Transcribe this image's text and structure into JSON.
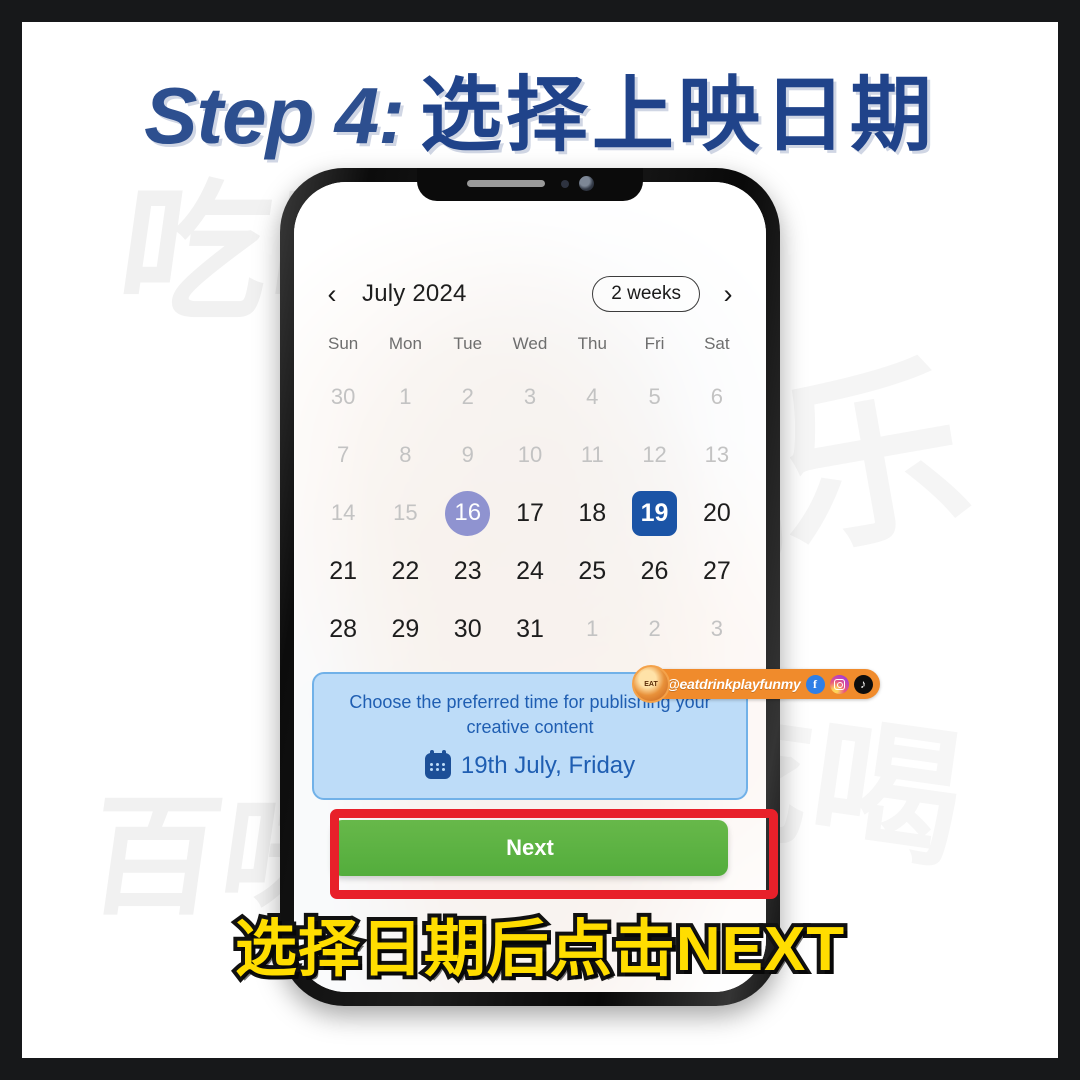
{
  "headline": {
    "english": "Step 4:",
    "chinese": "选择上映日期"
  },
  "background_watermark": {
    "line1": "吃喝",
    "line2": "百味玩",
    "line3": "玩乐",
    "line4": "吃喝"
  },
  "phone": {
    "notch": {
      "speaker": "speaker-grille",
      "sensor": "proximity-sensor",
      "camera": "front-camera"
    }
  },
  "calendar": {
    "prev_label": "‹",
    "next_label": "›",
    "month": "July 2024",
    "range_pill": "2 weeks",
    "weekdays": [
      "Sun",
      "Mon",
      "Tue",
      "Wed",
      "Thu",
      "Fri",
      "Sat"
    ],
    "weeks": [
      [
        {
          "d": "30",
          "state": "muted"
        },
        {
          "d": "1",
          "state": "muted"
        },
        {
          "d": "2",
          "state": "muted"
        },
        {
          "d": "3",
          "state": "muted"
        },
        {
          "d": "4",
          "state": "muted"
        },
        {
          "d": "5",
          "state": "muted"
        },
        {
          "d": "6",
          "state": "muted"
        }
      ],
      [
        {
          "d": "7",
          "state": "muted"
        },
        {
          "d": "8",
          "state": "muted"
        },
        {
          "d": "9",
          "state": "muted"
        },
        {
          "d": "10",
          "state": "muted"
        },
        {
          "d": "11",
          "state": "muted"
        },
        {
          "d": "12",
          "state": "muted"
        },
        {
          "d": "13",
          "state": "muted"
        }
      ],
      [
        {
          "d": "14",
          "state": "muted"
        },
        {
          "d": "15",
          "state": "muted"
        },
        {
          "d": "16",
          "state": "today"
        },
        {
          "d": "17",
          "state": "normal"
        },
        {
          "d": "18",
          "state": "normal"
        },
        {
          "d": "19",
          "state": "selected"
        },
        {
          "d": "20",
          "state": "normal"
        }
      ],
      [
        {
          "d": "21",
          "state": "normal"
        },
        {
          "d": "22",
          "state": "normal"
        },
        {
          "d": "23",
          "state": "normal"
        },
        {
          "d": "24",
          "state": "normal"
        },
        {
          "d": "25",
          "state": "normal"
        },
        {
          "d": "26",
          "state": "normal"
        },
        {
          "d": "27",
          "state": "normal"
        }
      ],
      [
        {
          "d": "28",
          "state": "normal"
        },
        {
          "d": "29",
          "state": "normal"
        },
        {
          "d": "30",
          "state": "normal"
        },
        {
          "d": "31",
          "state": "normal"
        },
        {
          "d": "1",
          "state": "muted"
        },
        {
          "d": "2",
          "state": "muted"
        },
        {
          "d": "3",
          "state": "muted"
        }
      ]
    ]
  },
  "info_box": {
    "message": "Choose the preferred time for publishing your creative content",
    "selected_date": "19th July, Friday",
    "icon": "calendar-icon"
  },
  "next_button": {
    "label": "Next"
  },
  "watermark": {
    "logo_text": "EAT",
    "handle": "@eatdrinkplayfunmy",
    "facebook": "f",
    "instagram": "instagram-icon",
    "tiktok": "♪"
  },
  "caption": {
    "text": "选择日期后点击NEXT"
  },
  "colors": {
    "headline_blue": "#20438a",
    "selected_date_blue": "#1b54a6",
    "today_purple": "#8f93d0",
    "info_box_fill": "#bddcf8",
    "info_box_border": "#71b1e8",
    "info_text_blue": "#1f5eb2",
    "next_green": "#53ad3c",
    "highlight_red": "#e8202a",
    "caption_yellow": "#ffdd00",
    "watermark_orange": "#f08b2c",
    "frame_black": "#17181a"
  }
}
